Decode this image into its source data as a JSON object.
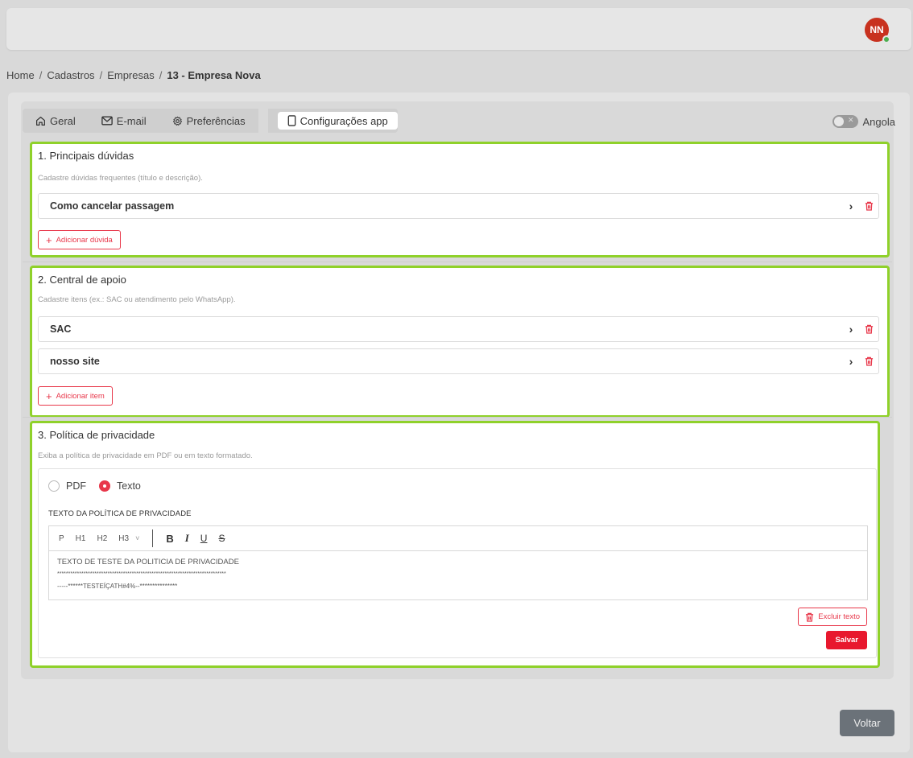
{
  "topbar": {
    "avatar_initials": "NN"
  },
  "breadcrumb": {
    "items": [
      "Home",
      "Cadastros",
      "Empresas"
    ],
    "current": "13 - Empresa Nova",
    "separator": "/"
  },
  "tabs": [
    {
      "label": "Geral",
      "icon": "home-icon"
    },
    {
      "label": "E-mail",
      "icon": "mail-icon"
    },
    {
      "label": "Preferências",
      "icon": "gear-icon"
    },
    {
      "label": "Configurações app",
      "icon": "phone-icon",
      "active": true
    }
  ],
  "toggle": {
    "label": "Angola",
    "on": false
  },
  "sections": {
    "faq": {
      "title": "1. Principais dúvidas",
      "desc": "Cadastre dúvidas frequentes (título e descrição).",
      "items": [
        "Como cancelar passagem"
      ],
      "add_label": "Adicionar dúvida"
    },
    "support": {
      "title": "2. Central de apoio",
      "desc": "Cadastre itens (ex.: SAC ou atendimento pelo WhatsApp).",
      "items": [
        "SAC",
        "nosso site"
      ],
      "add_label": "Adicionar item"
    },
    "privacy": {
      "title": "3. Política de privacidade",
      "desc": "Exiba a política de privacidade em PDF ou em texto formatado.",
      "radio_pdf": "PDF",
      "radio_text": "Texto",
      "selected": "Texto",
      "field_label": "TEXTO DA POLÍTICA DE PRIVACIDADE",
      "toolbar": {
        "p": "P",
        "h1": "H1",
        "h2": "H2",
        "h3": "H3",
        "bold": "B",
        "italic": "I",
        "underline": "U",
        "strike": "S"
      },
      "body_lines": [
        "TEXTO DE TESTE DA POLITICIA DE PRIVACIDADE",
        "*****************************************************************************",
        "-----******TESTEÍÇATH#4%--***************"
      ],
      "delete_label": "Excluir texto",
      "save_label": "Salvar"
    }
  },
  "footer": {
    "back_label": "Voltar"
  },
  "colors": {
    "accent_red": "#e8374a",
    "highlight_green": "#8fd12a",
    "avatar_bg": "#c8321f"
  }
}
